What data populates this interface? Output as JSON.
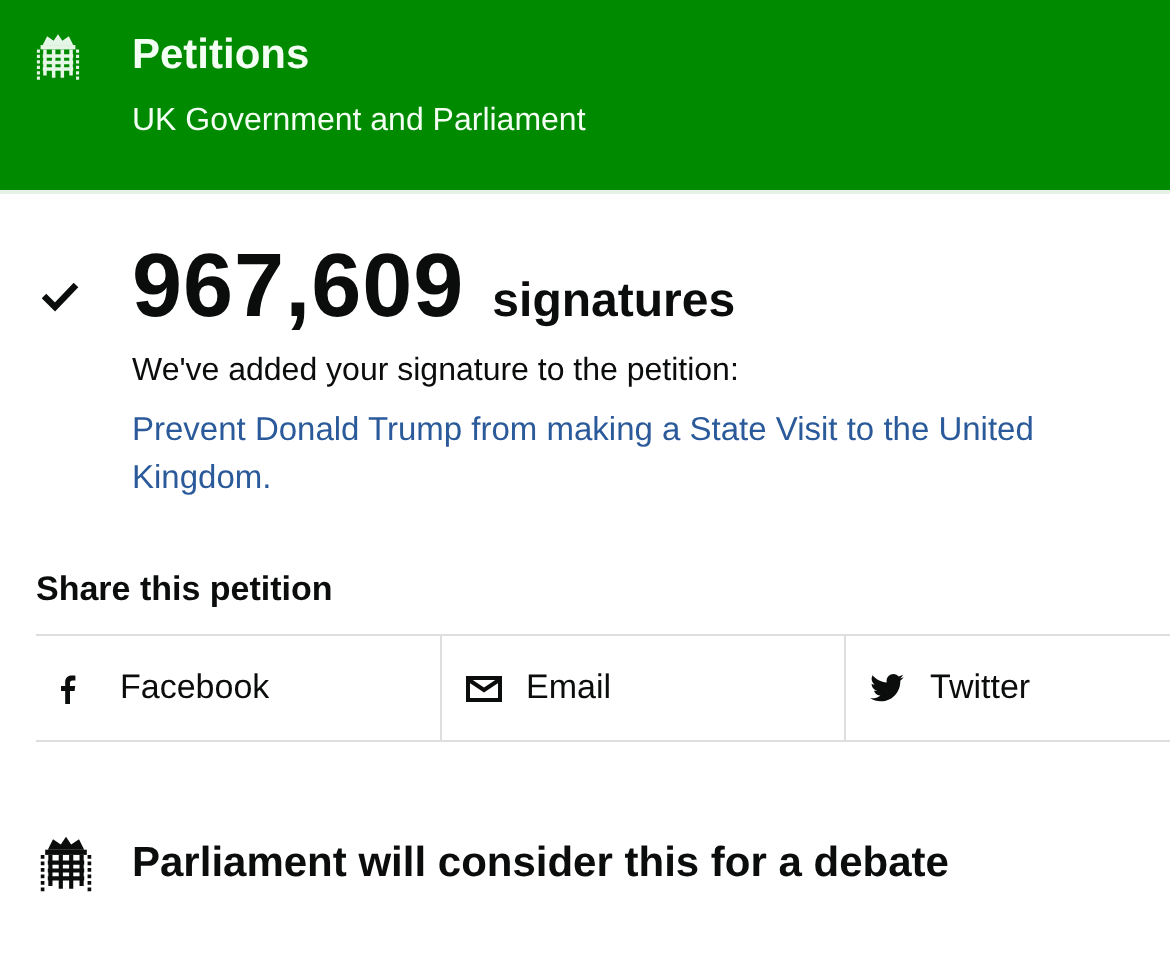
{
  "header": {
    "title": "Petitions",
    "subtitle": "UK Government and Parliament"
  },
  "signatures": {
    "count": "967,609",
    "unit": "signatures",
    "message": "We've added your signature to the petition:",
    "petition_link": "Prevent Donald Trump from making a State Visit to the United Kingdom."
  },
  "share": {
    "heading": "Share this petition",
    "buttons": [
      {
        "kind": "facebook",
        "label": "Facebook"
      },
      {
        "kind": "email",
        "label": "Email"
      },
      {
        "kind": "twitter",
        "label": "Twitter"
      }
    ]
  },
  "debate": {
    "heading": "Parliament will consider this for a debate"
  }
}
